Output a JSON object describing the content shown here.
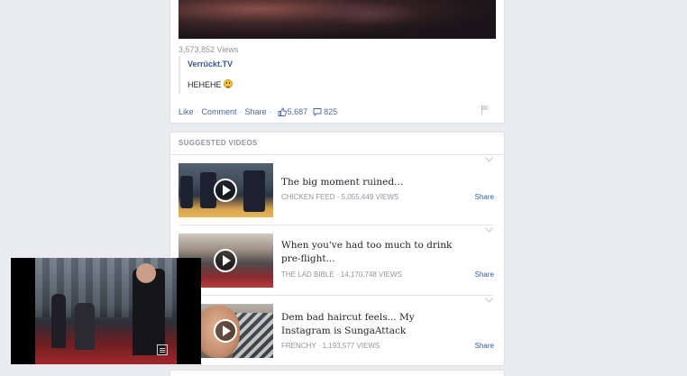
{
  "post": {
    "views": "3,573,852 Views",
    "shared_author": "Verrückt.TV",
    "shared_text": "HEHEHE",
    "actions": {
      "like": "Like",
      "comment": "Comment",
      "share": "Share",
      "like_count": "5,687",
      "comment_count": "825"
    }
  },
  "suggested": {
    "header": "SUGGESTED VIDEOS",
    "items": [
      {
        "title": "The big moment ruined...",
        "meta": "CHICKEN FEED · 5,055,449 VIEWS",
        "share": "Share"
      },
      {
        "title": "When you've had too much to drink pre-flight...",
        "meta": "THE LAD BIBLE · 14,170,748 VIEWS",
        "share": "Share"
      },
      {
        "title": "Dem bad haircut feels... My Instagram is SungaAttack",
        "meta": "FRENCHY · 1,193,577 VIEWS",
        "share": "Share"
      }
    ]
  },
  "colors": {
    "link": "#365899",
    "meta": "#90949c",
    "background": "#e9ebee"
  },
  "icons": {
    "like": "thumbs-up-icon",
    "comment": "comment-bubble-icon",
    "flag": "flag-icon",
    "chevron": "chevron-down-icon",
    "play": "play-icon",
    "emoji": "smiley-emoji-icon"
  }
}
